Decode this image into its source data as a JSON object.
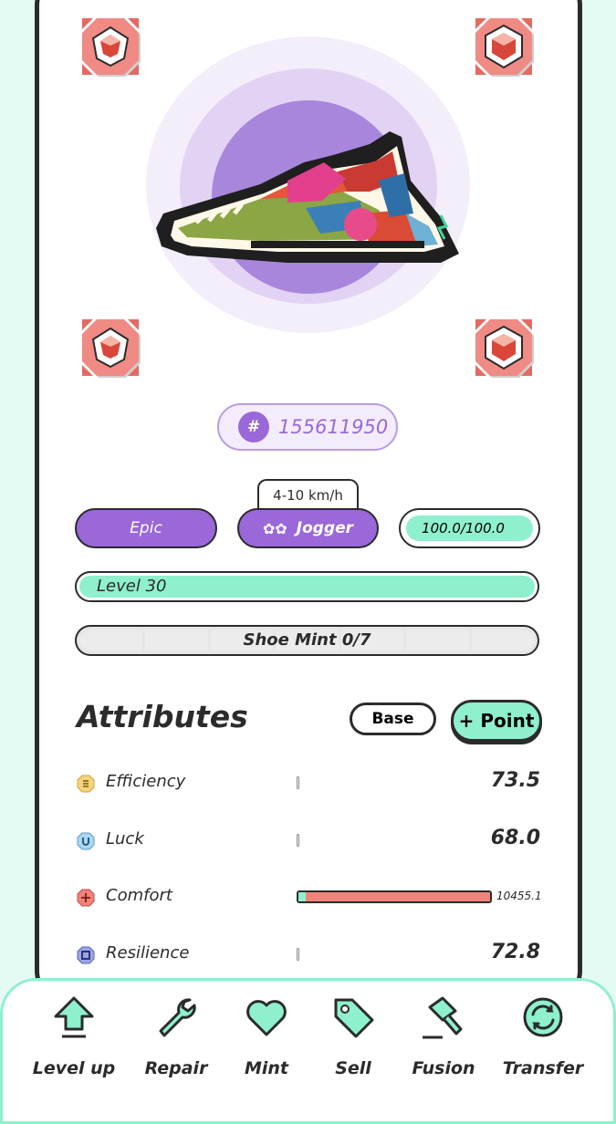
{
  "sneaker": {
    "id_hash": "#",
    "id_number": "155611950",
    "rarity": "Epic",
    "type": "Jogger",
    "speed_range": "4-10 km/h",
    "durability": "100.0/100.0",
    "durability_fraction": 1.0,
    "level": "Level 30",
    "level_fraction": 1.0,
    "mint": "Shoe Mint 0/7",
    "mint_segments_filled": 0,
    "mint_segments_total": 7
  },
  "gem_sockets": [
    {
      "name": "top-left",
      "icon": "gem-icon"
    },
    {
      "name": "top-right",
      "icon": "gem-icon"
    },
    {
      "name": "bottom-left",
      "icon": "gem-icon"
    },
    {
      "name": "bottom-right",
      "icon": "gem-icon"
    }
  ],
  "attributes": {
    "title": "Attributes",
    "base_label": "Base",
    "point_label": "+ Point",
    "items": [
      {
        "name": "Efficiency",
        "value": "73.5",
        "icon": "efficiency-icon",
        "color": "#f6d47a"
      },
      {
        "name": "Luck",
        "value": "68.0",
        "icon": "luck-icon",
        "color": "#a9d8f3"
      },
      {
        "name": "Comfort",
        "value": "10455.1",
        "icon": "comfort-icon",
        "color": "#f0837a",
        "bar_fraction": 1.0
      },
      {
        "name": "Resilience",
        "value": "72.8",
        "icon": "resilience-icon",
        "color": "#9aa6e8"
      }
    ]
  },
  "nav": [
    {
      "label": "Level up",
      "icon": "level-up-icon"
    },
    {
      "label": "Repair",
      "icon": "wrench-icon"
    },
    {
      "label": "Mint",
      "icon": "heart-icon"
    },
    {
      "label": "Sell",
      "icon": "tag-icon"
    },
    {
      "label": "Fusion",
      "icon": "hammer-icon"
    },
    {
      "label": "Transfer",
      "icon": "transfer-icon"
    }
  ],
  "colors": {
    "accent_purple": "#9a68d8",
    "accent_mint": "#8ff0cd",
    "gem_red": "#f08a84",
    "background": "#e3fbf2"
  }
}
